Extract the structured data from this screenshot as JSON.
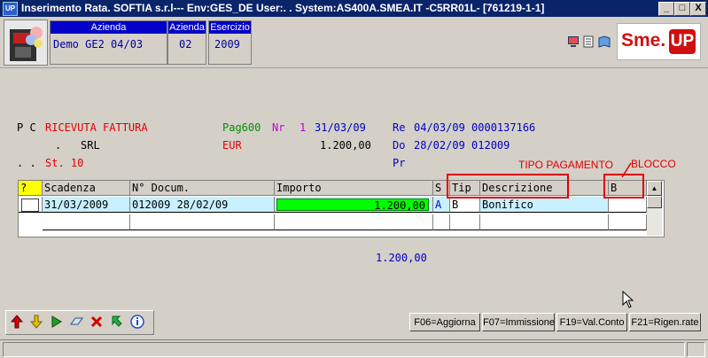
{
  "window": {
    "icon_label": "UP",
    "title": "Inserimento Rata. SOFTIA s.r.l--- Env:GES_DE User:.  . System:AS400A.SMEA.IT -C5RR01L- [761219-1-1]",
    "btn_min": "_",
    "btn_max": "□",
    "btn_close": "X"
  },
  "header": {
    "azienda_caption": "Azienda",
    "azienda_value": "Demo GE2 04/03",
    "azienda_code_caption": "Azienda",
    "azienda_code_value": "02",
    "esercizio_caption": "Esercizio",
    "esercizio_value": "2009",
    "brand": "Sme.",
    "brand_up": "UP"
  },
  "info": {
    "row1_left": "P C",
    "row1_doc": "RICEVUTA FATTURA",
    "row1_pag": "Pag600",
    "row1_nr_label": "Nr",
    "row1_nr_value": "1",
    "row1_date": "31/03/09",
    "row1_re_label": "Re",
    "row1_re_value": "04/03/09 0000137166",
    "row2_left": ".",
    "row2_name": "SRL",
    "row2_currency": "EUR",
    "row2_amount": "1.200,00",
    "row2_do_label": "Do",
    "row2_do_value": "28/02/09 012009",
    "row3_left": ". .",
    "row3_st": "St. 10",
    "row3_pr": "Pr"
  },
  "annotations": {
    "tipo_pagamento": "TIPO PAGAMENTO",
    "blocco": "BLOCCO"
  },
  "table": {
    "headers": {
      "q": "?",
      "scadenza": "Scadenza",
      "docum": "N° Docum.",
      "importo": "Importo",
      "s": "S",
      "tip": "Tip",
      "descrizione": "Descrizione",
      "b": "B"
    },
    "rows": [
      {
        "scadenza": "31/03/2009",
        "docum": "012009   28/02/09",
        "importo": "1.200,00",
        "s": "A",
        "tip": "B",
        "descrizione": "Bonifico",
        "b": ""
      }
    ],
    "scroll_up": "▲"
  },
  "total": "1.200,00",
  "toolbar": {
    "tools": [
      "up-arrow",
      "down-arrow",
      "play",
      "clear",
      "delete",
      "return",
      "info"
    ]
  },
  "fkeys": {
    "f06": "F06=Aggiorna",
    "f07": "F07=Immissione",
    "f19": "F19=Val.Conto",
    "f21": "F21=Rigen.rate"
  },
  "colors": {
    "title_bar": "#0a246a",
    "caption_blue": "#0000c8",
    "importo_green": "#00ff00",
    "annotation_red": "#e00000"
  }
}
